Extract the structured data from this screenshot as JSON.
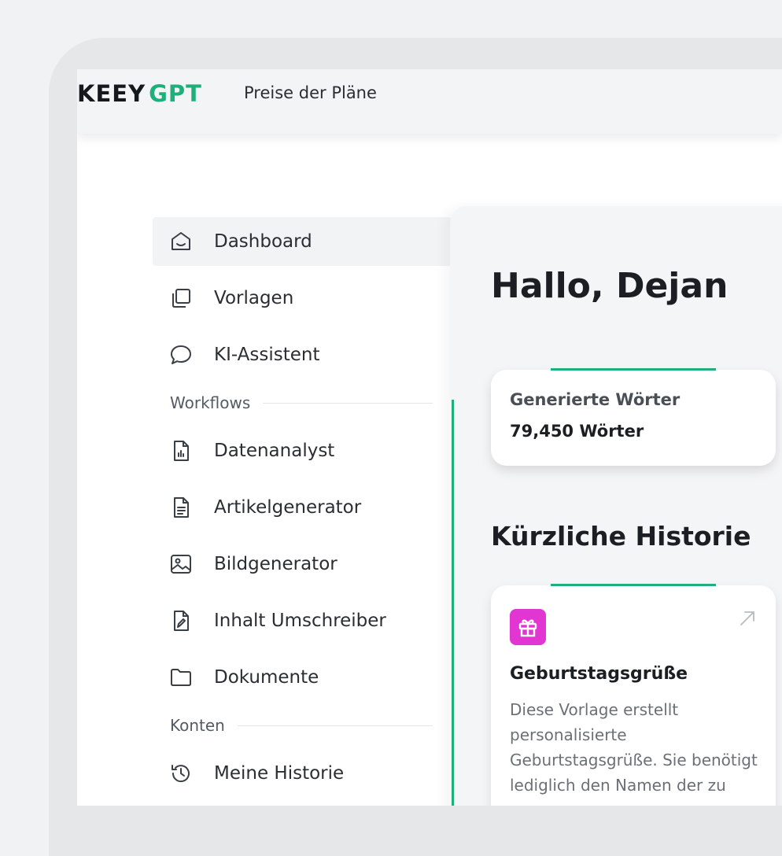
{
  "header": {
    "logo_left": "KEEY",
    "logo_right": "GPT",
    "nav_plans": "Preise der Pläne"
  },
  "sidebar": {
    "items": [
      {
        "label": "Dashboard",
        "icon": "home-icon"
      },
      {
        "label": "Vorlagen",
        "icon": "templates-icon"
      },
      {
        "label": "KI-Assistent",
        "icon": "chat-icon"
      }
    ],
    "sections": [
      {
        "label": "Workflows",
        "items": [
          {
            "label": "Datenanalyst",
            "icon": "chart-file-icon"
          },
          {
            "label": "Artikelgenerator",
            "icon": "document-icon"
          },
          {
            "label": "Bildgenerator",
            "icon": "image-icon"
          },
          {
            "label": "Inhalt Umschreiber",
            "icon": "edit-file-icon"
          },
          {
            "label": "Dokumente",
            "icon": "folder-icon"
          }
        ]
      },
      {
        "label": "Konten",
        "items": [
          {
            "label": "Meine Historie",
            "icon": "history-icon"
          }
        ]
      }
    ]
  },
  "main": {
    "greeting": "Hallo, Dejan",
    "stat": {
      "label": "Generierte Wörter",
      "value": "79,450 Wörter"
    },
    "history_title": "Kürzliche Historie",
    "history_card": {
      "title": "Geburtstagsgrüße",
      "description": "Diese Vorlage erstellt personalisierte Geburtstagsgrüße. Sie benötigt lediglich den Namen der zu",
      "icon": "gift-icon",
      "action_icon": "open-arrow-icon"
    }
  },
  "colors": {
    "accent": "#1faf7a",
    "gift_badge": "#e236d2"
  }
}
